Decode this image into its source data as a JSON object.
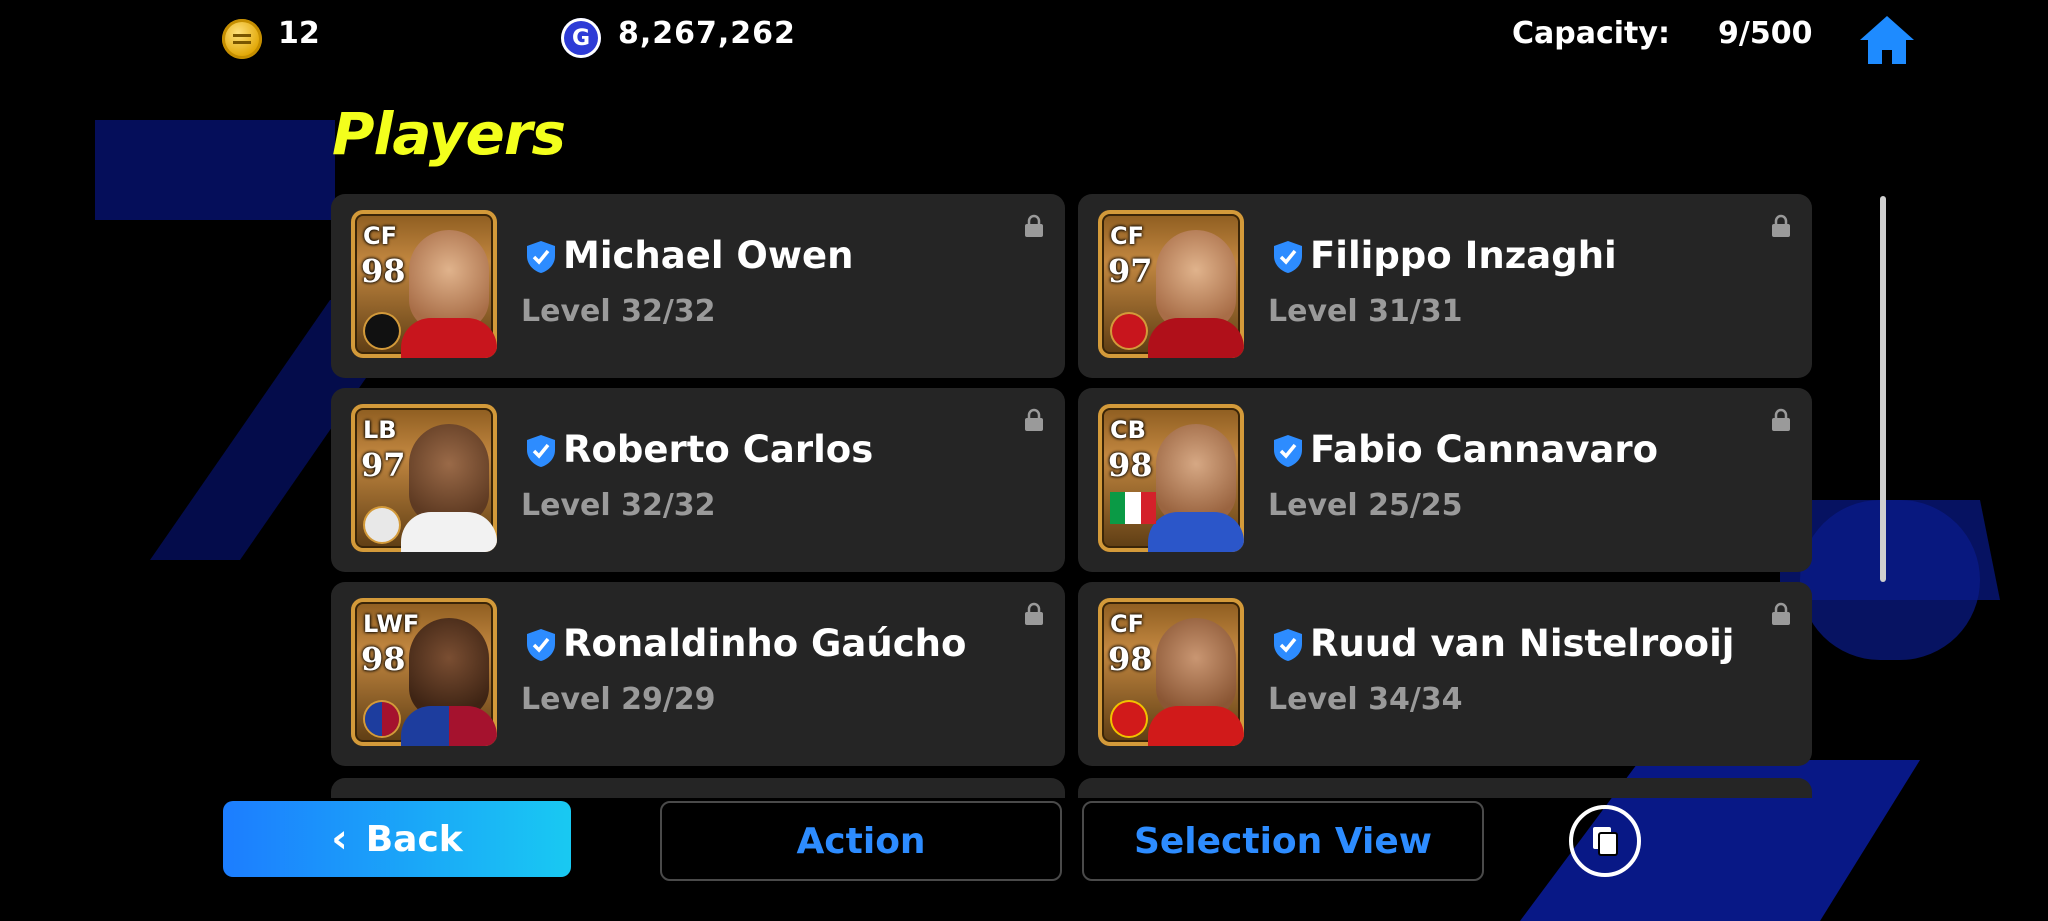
{
  "topbar": {
    "coins": "12",
    "gp_icon": "G",
    "gp": "8,267,262",
    "capacity_label": "Capacity:",
    "capacity_value": "9/500"
  },
  "page_title": "Players",
  "players": [
    {
      "position": "CF",
      "rating": "98",
      "name": "Michael Owen",
      "level": "Level 32/32"
    },
    {
      "position": "CF",
      "rating": "97",
      "name": "Filippo Inzaghi",
      "level": "Level 31/31"
    },
    {
      "position": "LB",
      "rating": "97",
      "name": "Roberto Carlos",
      "level": "Level 32/32"
    },
    {
      "position": "CB",
      "rating": "98",
      "name": "Fabio Cannavaro",
      "level": "Level 25/25"
    },
    {
      "position": "LWF",
      "rating": "98",
      "name": "Ronaldinho Gaúcho",
      "level": "Level 29/29"
    },
    {
      "position": "CF",
      "rating": "98",
      "name": "Ruud van Nistelrooij",
      "level": "Level 34/34"
    }
  ],
  "footer": {
    "back_label": "Back",
    "action_label": "Action",
    "selection_view_label": "Selection View"
  },
  "colors": {
    "title": "#f3ff1c",
    "accent_blue": "#2d8cff",
    "card_bg": "#252525",
    "background": "#000000"
  }
}
